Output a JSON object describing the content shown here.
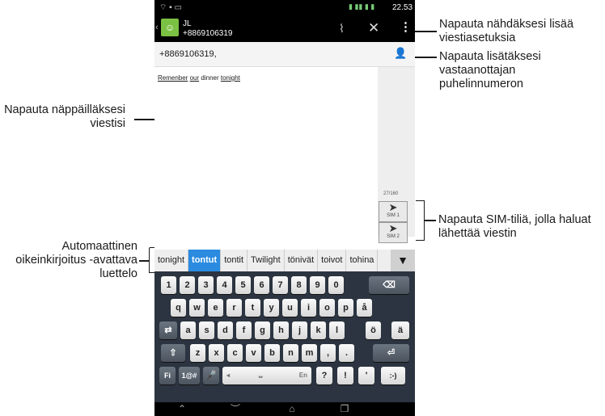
{
  "status": {
    "time": "22.53"
  },
  "header": {
    "name": "JL",
    "number": "+8869106319"
  },
  "recipient": {
    "value": "+8869106319,"
  },
  "message": {
    "words": [
      "Remenber",
      "our",
      "dinner",
      "tonight"
    ]
  },
  "counter": "27/160",
  "sim": [
    "SIM 1",
    "SIM 2"
  ],
  "suggestions": [
    "tonight",
    "tontut",
    "tontit",
    "Twilight",
    "tönivät",
    "toivot",
    "tohina"
  ],
  "keyboard": {
    "row1": [
      "1",
      "2",
      "3",
      "4",
      "5",
      "6",
      "7",
      "8",
      "9",
      "0"
    ],
    "row2": [
      "q",
      "w",
      "e",
      "r",
      "t",
      "y",
      "u",
      "i",
      "o",
      "p",
      "å"
    ],
    "row3": [
      "a",
      "s",
      "d",
      "f",
      "g",
      "h",
      "j",
      "k",
      "l",
      "ö",
      "ä"
    ],
    "row4": [
      "z",
      "x",
      "c",
      "v",
      "b",
      "n",
      "m",
      ",",
      "."
    ],
    "row5": {
      "lang": "Fi",
      "sym": "1@#",
      "space_lang": "En",
      "q": "?",
      "ex": "!",
      "ap": "'",
      "smile": ":-)"
    }
  },
  "callouts": {
    "menu": "Napauta nähdäksesi lisää viestiasetuksia",
    "add_recipient": "Napauta lisätäksesi vastaanottajan puhelinnumeron",
    "type_message": "Napauta näppäilläksesi viestisi",
    "sim": "Napauta SIM-tiliä, jolla haluat lähettää viestin",
    "autocorrect": "Automaattinen oikeinkirjoitus -avattava luettelo"
  }
}
